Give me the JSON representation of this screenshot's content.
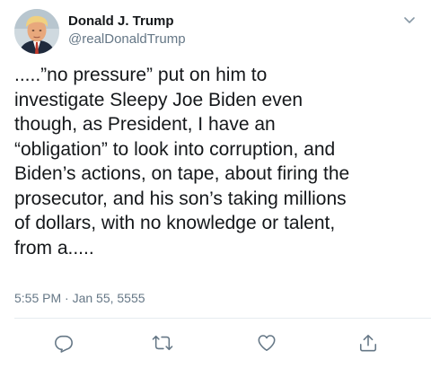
{
  "tweet": {
    "author": {
      "display_name": "Donald J. Trump",
      "handle": "@realDonaldTrump"
    },
    "text_lines": [
      ".....”no pressure” put on him to",
      "investigate Sleepy Joe Biden even",
      "though, as President, I have an",
      "“obligation” to look into corruption, and",
      "Biden’s actions, on tape, about firing the",
      "prosecutor, and his son’s taking millions",
      "of dollars, with no knowledge or talent,",
      "from a....."
    ],
    "timestamp": "5:55 PM · Jan 55, 5555"
  },
  "actions": [
    {
      "name": "reply",
      "icon": "reply-icon"
    },
    {
      "name": "retweet",
      "icon": "retweet-icon"
    },
    {
      "name": "like",
      "icon": "heart-icon"
    },
    {
      "name": "share",
      "icon": "share-icon"
    }
  ],
  "colors": {
    "primary_text": "#14171a",
    "secondary_text": "#657786",
    "divider": "#e6ecf0",
    "icon": "#657786"
  }
}
